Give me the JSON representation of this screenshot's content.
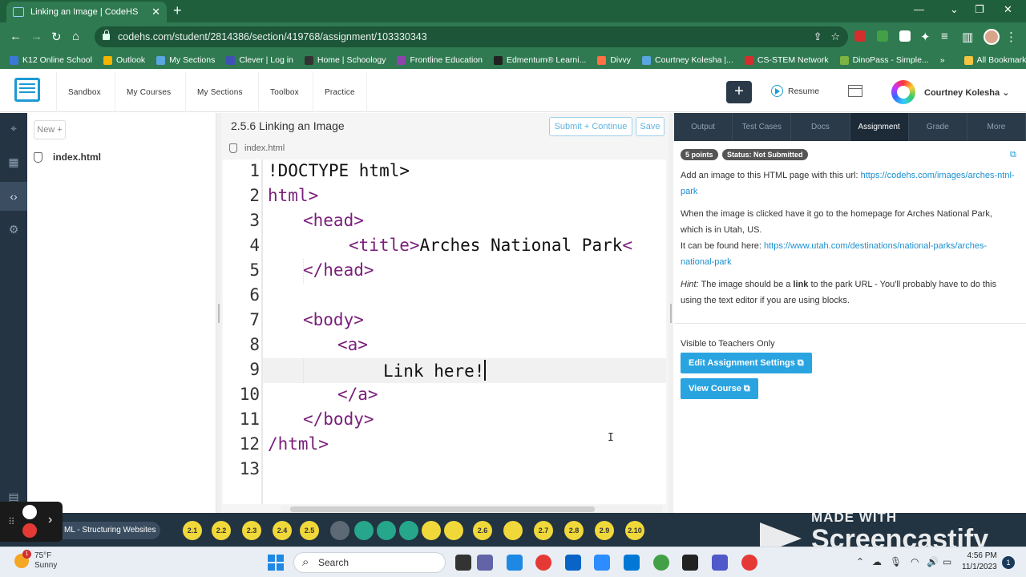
{
  "browser": {
    "tab_title": "Linking an Image | CodeHS",
    "url": "codehs.com/student/2814386/section/419768/assignment/103330343",
    "bookmarks": [
      {
        "label": "K12 Online School",
        "color": "#3c78d8"
      },
      {
        "label": "Outlook",
        "color": "#f4b400"
      },
      {
        "label": "My Sections",
        "color": "#5aa6e0"
      },
      {
        "label": "Clever | Log in",
        "color": "#3f51b5"
      },
      {
        "label": "Home | Schoology",
        "color": "#333333"
      },
      {
        "label": "Frontline Education",
        "color": "#8e44ad"
      },
      {
        "label": "Edmentum® Learni...",
        "color": "#222222"
      },
      {
        "label": "Divvy",
        "color": "#ff7043"
      },
      {
        "label": "Courtney Kolesha |...",
        "color": "#5aa6e0"
      },
      {
        "label": "CS-STEM Network",
        "color": "#d32f2f"
      },
      {
        "label": "DinoPass - Simple...",
        "color": "#7cb342"
      }
    ],
    "more_bookmarks": "»",
    "all_bookmarks": "All Bookmarks"
  },
  "app": {
    "nav": [
      "Sandbox",
      "My Courses",
      "My Sections",
      "Toolbox",
      "Practice"
    ],
    "resume_label": "Resume",
    "username": "Courtney Kolesha"
  },
  "files": {
    "new_label": "New +",
    "items": [
      "index.html"
    ]
  },
  "editor": {
    "title": "2.5.6 Linking an Image",
    "submit_label": "Submit + Continue",
    "save_label": "Save",
    "file_tab": "index.html",
    "line_numbers": [
      "1",
      "2",
      "3",
      "4",
      "5",
      "6",
      "7",
      "8",
      "9",
      "10",
      "11",
      "12",
      "13"
    ],
    "lines": [
      "!DOCTYPE html>",
      "html>",
      "<head>",
      "<title>",
      "Arches National Park",
      "<",
      "</head>",
      "<body>",
      "<a>",
      "Link here!",
      "</a>",
      "</body>",
      "/html>"
    ]
  },
  "panel": {
    "tabs": [
      "Output",
      "Test Cases",
      "Docs",
      "Assignment",
      "Grade",
      "More"
    ],
    "active_tab": "Assignment",
    "points_badge": "5 points",
    "status_badge": "Status: Not Submitted",
    "p1_text": "Add an image to this HTML page with this url: ",
    "p1_link": "https://codehs.com/images/arches-ntnl-park",
    "p2_text": "When the image is clicked have it go to the homepage for Arches National Park, which is in Utah, US.",
    "p3_text": "It can be found here: ",
    "p3_link": "https://www.utah.com/destinations/national-parks/arches-national-park",
    "hint_label": "Hint:",
    "hint_a": " The image should be a ",
    "hint_bold": "link",
    "hint_b": " to the park URL - You'll probably have to do this using the text editor if you are using blocks.",
    "teacher_note": "Visible to Teachers Only",
    "edit_btn": "Edit Assignment Settings",
    "view_btn": "View Course"
  },
  "lessonbar": {
    "lesson": "ML - Structuring Websites",
    "dots": [
      {
        "label": "2.1",
        "kind": "y"
      },
      {
        "label": "2.2",
        "kind": "y"
      },
      {
        "label": "2.3",
        "kind": "y"
      },
      {
        "label": "2.4",
        "kind": "y"
      },
      {
        "label": "2.5",
        "kind": "y"
      },
      {
        "label": "",
        "kind": "gr"
      },
      {
        "label": "",
        "kind": "g"
      },
      {
        "label": "",
        "kind": "g"
      },
      {
        "label": "",
        "kind": "g"
      },
      {
        "label": "",
        "kind": "y"
      },
      {
        "label": "",
        "kind": "y"
      },
      {
        "label": "2.6",
        "kind": "y"
      },
      {
        "label": "",
        "kind": "y"
      },
      {
        "label": "2.7",
        "kind": "y"
      },
      {
        "label": "2.8",
        "kind": "y"
      },
      {
        "label": "2.9",
        "kind": "y"
      },
      {
        "label": "2.10",
        "kind": "y"
      }
    ]
  },
  "watermark": {
    "made_with": "MADE WITH",
    "brand": "Screencastify"
  },
  "taskbar": {
    "temp": "75°F",
    "weather": "Sunny",
    "weather_badge": "1",
    "search": "Search",
    "time": "4:56 PM",
    "date": "11/1/2023",
    "notifications": "1"
  }
}
